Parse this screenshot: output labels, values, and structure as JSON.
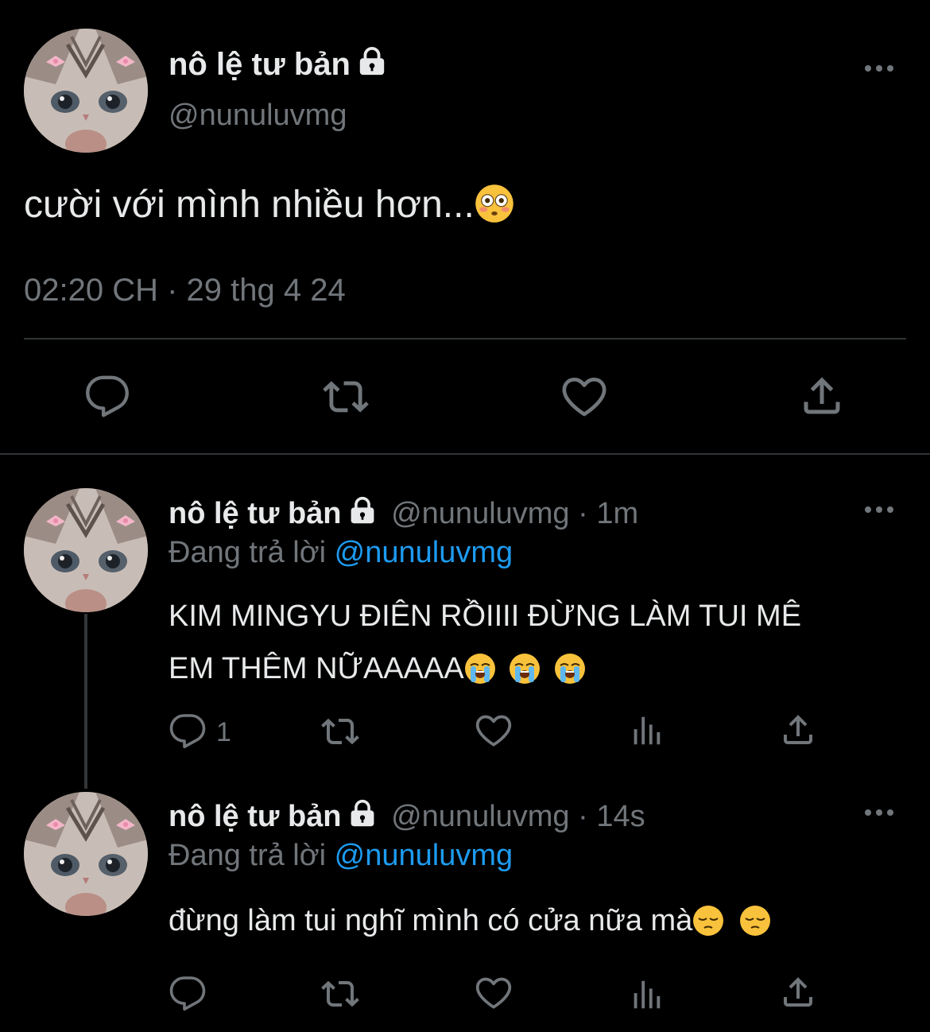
{
  "main_tweet": {
    "display_name": "nô lệ tư bản",
    "handle": "@nunuluvmg",
    "text": "cười với mình nhiều hơn...",
    "timestamp": "02:20 CH · 29 thg 4 24"
  },
  "replies": [
    {
      "display_name": "nô lệ tư bản",
      "handle": "@nunuluvmg",
      "time": "· 1m",
      "replying_prefix": "Đang trả lời",
      "replying_to": "@nunuluvmg",
      "text_line1": "KIM MINGYU ĐIÊN RỒIIII ĐỪNG LÀM TUI MÊ",
      "text_line2": "EM THÊM NỮAAAAA",
      "reply_count": "1"
    },
    {
      "display_name": "nô lệ tư bản",
      "handle": "@nunuluvmg",
      "time": "· 14s",
      "replying_prefix": "Đang trả lời",
      "replying_to": "@nunuluvmg",
      "text": "đừng làm tui nghĩ mình có cửa nữa mà",
      "reply_count": ""
    }
  ],
  "icons": [
    "lock-icon",
    "more-icon",
    "reply-icon",
    "retweet-icon",
    "like-icon",
    "share-icon",
    "analytics-icon",
    "flushed-emoji",
    "crying-emoji",
    "pensive-emoji"
  ],
  "colors": {
    "background": "#000000",
    "text": "#e7e9ea",
    "secondary": "#71767b",
    "link": "#1d9bf0",
    "divider": "#2f3336"
  }
}
